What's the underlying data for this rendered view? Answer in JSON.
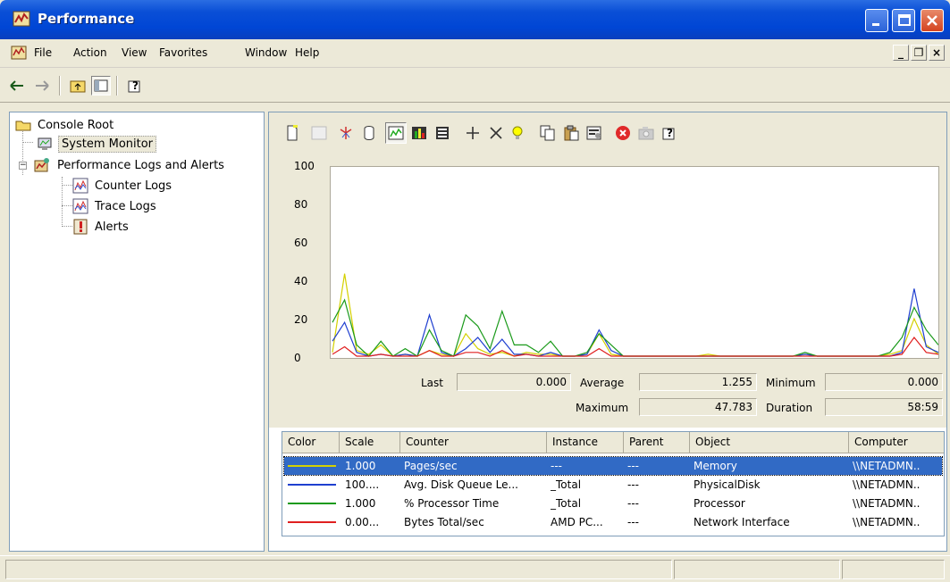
{
  "window": {
    "title": "Performance"
  },
  "menu": {
    "items": [
      "File",
      "Action",
      "View",
      "Favorites",
      "Window",
      "Help"
    ]
  },
  "tree": {
    "root": "Console Root",
    "system_monitor": "System Monitor",
    "perf_logs": "Performance Logs and Alerts",
    "counter_logs": "Counter Logs",
    "trace_logs": "Trace Logs",
    "alerts": "Alerts"
  },
  "stats": {
    "last_label": "Last",
    "last_value": "0.000",
    "average_label": "Average",
    "average_value": "1.255",
    "minimum_label": "Minimum",
    "minimum_value": "0.000",
    "maximum_label": "Maximum",
    "maximum_value": "47.783",
    "duration_label": "Duration",
    "duration_value": "58:59"
  },
  "legend": {
    "headers": [
      "Color",
      "Scale",
      "Counter",
      "Instance",
      "Parent",
      "Object",
      "Computer"
    ],
    "rows": [
      {
        "color": "#d4d000",
        "scale": "1.000",
        "counter": "Pages/sec",
        "instance": "---",
        "parent": "---",
        "object": "Memory",
        "computer": "\\\\NETADMN.."
      },
      {
        "color": "#1f3fd0",
        "scale": "100....",
        "counter": "Avg. Disk Queue Le...",
        "instance": "_Total",
        "parent": "---",
        "object": "PhysicalDisk",
        "computer": "\\\\NETADMN.."
      },
      {
        "color": "#1a9a1a",
        "scale": "1.000",
        "counter": "% Processor Time",
        "instance": "_Total",
        "parent": "---",
        "object": "Processor",
        "computer": "\\\\NETADMN.."
      },
      {
        "color": "#e02020",
        "scale": "0.00...",
        "counter": "Bytes Total/sec",
        "instance": "AMD PC...",
        "parent": "---",
        "object": "Network Interface",
        "computer": "\\\\NETADMN.."
      }
    ]
  },
  "chart_data": {
    "type": "line",
    "ylim": [
      0,
      100
    ],
    "yticks": [
      "100",
      "80",
      "60",
      "40",
      "20",
      "0"
    ],
    "grid": false,
    "legend": "table-below",
    "x": [
      0,
      2,
      4,
      6,
      8,
      10,
      12,
      14,
      16,
      18,
      20,
      22,
      24,
      26,
      28,
      30,
      32,
      34,
      36,
      38,
      40,
      42,
      44,
      46,
      48,
      50,
      52,
      54,
      56,
      58,
      60,
      62,
      64,
      66,
      68,
      70,
      72,
      74,
      76,
      78,
      80,
      82,
      84,
      86,
      88,
      90,
      92,
      94,
      96,
      98,
      100
    ],
    "series": [
      {
        "name": "Pages/sec",
        "color": "#d4d000",
        "values": [
          2,
          44,
          3,
          1,
          6,
          0,
          1,
          0,
          3,
          1,
          0,
          12,
          4,
          1,
          2,
          0,
          2,
          1,
          1,
          0,
          0,
          1,
          12,
          1,
          0,
          0,
          0,
          0,
          0,
          0,
          0,
          1,
          0,
          0,
          0,
          0,
          0,
          0,
          0,
          1,
          0,
          0,
          0,
          0,
          0,
          0,
          1,
          3,
          20,
          6,
          1
        ]
      },
      {
        "name": "Avg. Disk Queue Length",
        "color": "#1f3fd0",
        "values": [
          8,
          18,
          2,
          0,
          1,
          0,
          1,
          0,
          22,
          2,
          0,
          4,
          10,
          2,
          9,
          1,
          1,
          0,
          2,
          0,
          0,
          1,
          14,
          3,
          0,
          0,
          0,
          0,
          0,
          0,
          0,
          0,
          0,
          0,
          0,
          0,
          0,
          0,
          0,
          1,
          0,
          0,
          0,
          0,
          0,
          0,
          0,
          2,
          36,
          5,
          2
        ]
      },
      {
        "name": "% Processor Time",
        "color": "#1a9a1a",
        "values": [
          18,
          30,
          6,
          0,
          8,
          0,
          4,
          0,
          14,
          3,
          0,
          22,
          16,
          4,
          24,
          6,
          6,
          2,
          8,
          0,
          0,
          2,
          12,
          6,
          0,
          0,
          0,
          0,
          0,
          0,
          0,
          0,
          0,
          0,
          0,
          0,
          0,
          0,
          0,
          2,
          0,
          0,
          0,
          0,
          0,
          0,
          2,
          10,
          26,
          14,
          6
        ]
      },
      {
        "name": "Bytes Total/sec",
        "color": "#e02020",
        "values": [
          1,
          5,
          0,
          0,
          1,
          0,
          0,
          0,
          3,
          0,
          0,
          2,
          2,
          0,
          3,
          0,
          1,
          0,
          0,
          0,
          0,
          0,
          4,
          0,
          0,
          0,
          0,
          0,
          0,
          0,
          0,
          0,
          0,
          0,
          0,
          0,
          0,
          0,
          0,
          0,
          0,
          0,
          0,
          0,
          0,
          0,
          0,
          1,
          10,
          2,
          1
        ]
      }
    ]
  }
}
